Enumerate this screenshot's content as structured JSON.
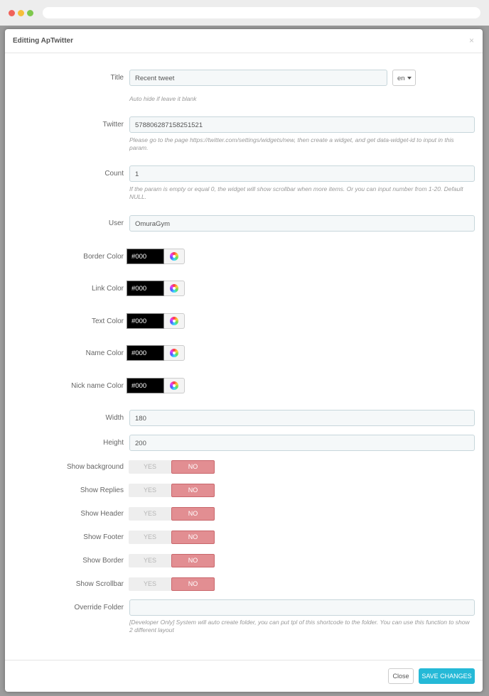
{
  "modal": {
    "title": "Editting ApTwitter",
    "close_symbol": "×"
  },
  "fields": {
    "title": {
      "label": "Title",
      "value": "Recent tweet",
      "lang": "en",
      "help": "Auto hide if leave it blank"
    },
    "twitter": {
      "label": "Twitter",
      "value": "578806287158251521",
      "help": "Please go to the page https://twitter.com/settings/widgets/new, then create a widget, and get data-widget-id to input in this param."
    },
    "count": {
      "label": "Count",
      "value": "1",
      "help": "If the param is empty or equal 0, the widget will show scrollbar when more items. Or you can input number from 1-20. Default NULL."
    },
    "user": {
      "label": "User",
      "value": "OmuraGym"
    },
    "colors": [
      {
        "label": "Border Color",
        "value": "#000"
      },
      {
        "label": "Link Color",
        "value": "#000"
      },
      {
        "label": "Text Color",
        "value": "#000"
      },
      {
        "label": "Name Color",
        "value": "#000"
      },
      {
        "label": "Nick name Color",
        "value": "#000"
      }
    ],
    "width": {
      "label": "Width",
      "value": "180"
    },
    "height": {
      "label": "Height",
      "value": "200"
    },
    "toggles": [
      {
        "label": "Show background",
        "yes": "YES",
        "no": "NO",
        "selected": "NO"
      },
      {
        "label": "Show Replies",
        "yes": "YES",
        "no": "NO",
        "selected": "NO"
      },
      {
        "label": "Show Header",
        "yes": "YES",
        "no": "NO",
        "selected": "NO"
      },
      {
        "label": "Show Footer",
        "yes": "YES",
        "no": "NO",
        "selected": "NO"
      },
      {
        "label": "Show Border",
        "yes": "YES",
        "no": "NO",
        "selected": "NO"
      },
      {
        "label": "Show Scrollbar",
        "yes": "YES",
        "no": "NO",
        "selected": "NO"
      }
    ],
    "override_folder": {
      "label": "Override Folder",
      "value": "",
      "help": "[Developer Only] System will auto create folder, you can put tpl of this shortcode to the folder. You can use this function to show 2 different layout"
    }
  },
  "footer": {
    "close_label": "Close",
    "save_label": "SAVE CHANGES"
  },
  "theme": {
    "accent": "#25b9d7",
    "no_active": "#e28e92"
  },
  "icons": {
    "color_picker": "color-wheel-icon",
    "lang_caret": "caret-down-icon"
  }
}
